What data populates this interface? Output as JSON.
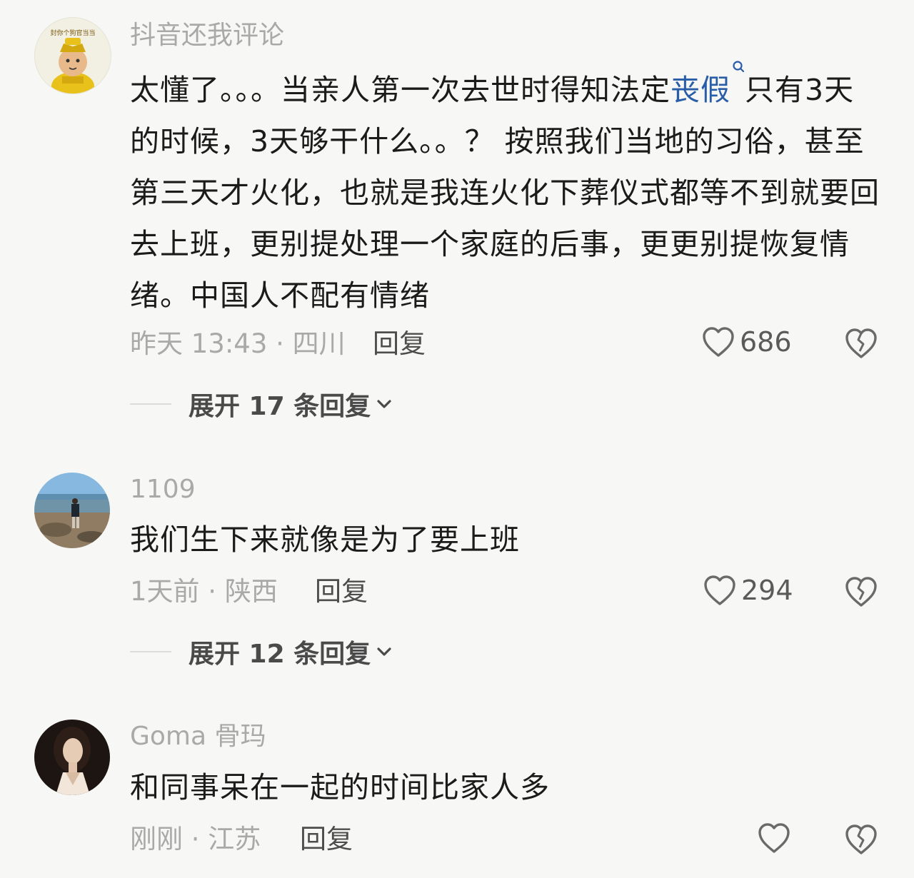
{
  "comments": [
    {
      "username": "抖音还我评论",
      "avatar_text": "封你个狗官当当",
      "text_before": "太懂了。。。当亲人第一次去世时得知法定",
      "text_highlight": "丧假",
      "text_after": "只有3天的时候，3天够干什么。。？ 按照我们当地的习俗，甚至第三天才火化，也就是我连火化下葬仪式都等不到就要回去上班，更别提处理一个家庭的后事，更更别提恢复情绪。中国人不配有情绪",
      "meta": "昨天 13:43 · 四川",
      "reply_label": "回复",
      "likes": "686",
      "expand_label": "展开 17 条回复"
    },
    {
      "username": "1109",
      "text": "我们生下来就像是为了要上班",
      "meta": "1天前 · 陕西",
      "reply_label": "回复",
      "likes": "294",
      "expand_label": "展开 12 条回复"
    },
    {
      "username": "Goma 骨玛",
      "text": "和同事呆在一起的时间比家人多",
      "meta": "刚刚 · 江苏",
      "reply_label": "回复",
      "likes": ""
    }
  ],
  "icons": {
    "like": "heart-outline-icon",
    "dislike": "broken-heart-icon",
    "expand": "chevron-down-icon",
    "search": "search-icon"
  },
  "colors": {
    "background": "#f7f7f5",
    "text": "#1b1b1b",
    "muted": "#a9a9a9",
    "highlight": "#2a5da8"
  }
}
